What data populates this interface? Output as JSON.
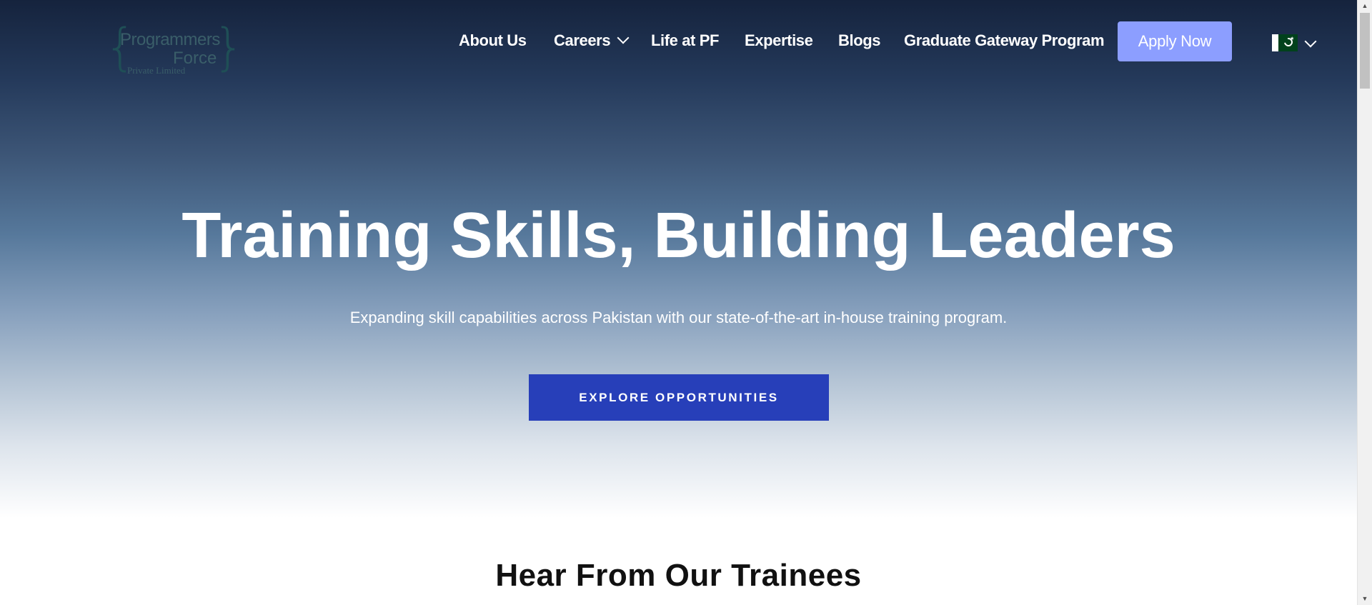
{
  "logo": {
    "brace_open": "{",
    "brace_close": "}",
    "line1": "Programmers",
    "line2": "Force",
    "line3": "Private Limited"
  },
  "nav": {
    "about": "About Us",
    "careers": "Careers",
    "life": "Life at PF",
    "expertise": "Expertise",
    "blogs": "Blogs",
    "graduate": "Graduate Gateway Program",
    "apply": "Apply Now"
  },
  "language": {
    "flag_icon": "pakistan-flag-icon",
    "dropdown_icon": "chevron-down-icon"
  },
  "hero": {
    "title": "Training Skills, Building Leaders",
    "subtitle": "Expanding skill capabilities across Pakistan with our state-of-the-art in-house training program.",
    "cta": "EXPLORE OPPORTUNITIES"
  },
  "section": {
    "title": "Hear From Our Trainees"
  },
  "scrollbar": {
    "up": "▲",
    "down": "▼"
  },
  "colors": {
    "apply_button": "#8c9eff",
    "cta_button": "#273fb9",
    "hero_top": "#15233d"
  }
}
